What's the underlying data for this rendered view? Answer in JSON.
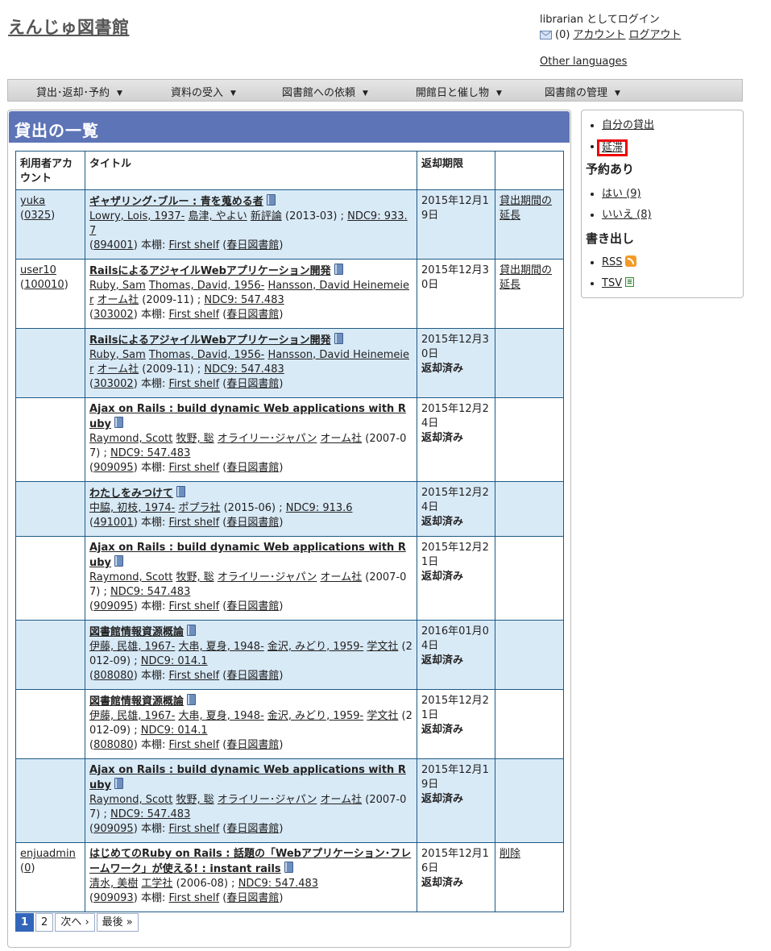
{
  "header": {
    "site_title": "えんじゅ図書館",
    "login_text": "librarian としてログイン",
    "message_count": "(0)",
    "account_link": "アカウント",
    "logout_link": "ログアウト",
    "other_languages": "Other languages"
  },
  "menu": [
    {
      "label": "貸出･返却･予約"
    },
    {
      "label": "資料の受入"
    },
    {
      "label": "図書館への依頼"
    },
    {
      "label": "開館日と催し物"
    },
    {
      "label": "図書館の管理"
    }
  ],
  "main": {
    "title": "貸出の一覧",
    "columns": [
      "利用者アカウント",
      "タイトル",
      "返却期限",
      ""
    ]
  },
  "rows": [
    {
      "user": "yuka",
      "user_id": "0325",
      "title": "ギャザリング･ブルー : 青を蒐める者",
      "authors": [
        "Lowry, Lois, 1937-",
        "島津, やよい"
      ],
      "publisher": "新評論",
      "date": "(2013-03)",
      "ndc": "NDC9: 933.7",
      "item_id": "894001",
      "shelf_label": "本棚:",
      "shelf": "First shelf",
      "library": "春日図書館",
      "due": "2015年12月19日",
      "returned": "",
      "action": "貸出期間の延長"
    },
    {
      "user": "user10",
      "user_id": "100010",
      "title": "RailsによるアジャイルWebアプリケーション開発",
      "authors": [
        "Ruby, Sam",
        "Thomas, David, 1956-",
        "Hansson, David Heinemeier"
      ],
      "publisher": "オーム社",
      "date": "(2009-11)",
      "ndc": "NDC9: 547.483",
      "item_id": "303002",
      "shelf_label": "本棚:",
      "shelf": "First shelf",
      "library": "春日図書館",
      "due": "2015年12月30日",
      "returned": "",
      "action": "貸出期間の延長"
    },
    {
      "user": "",
      "user_id": "",
      "title": "RailsによるアジャイルWebアプリケーション開発",
      "authors": [
        "Ruby, Sam",
        "Thomas, David, 1956-",
        "Hansson, David Heinemeier"
      ],
      "publisher": "オーム社",
      "date": "(2009-11)",
      "ndc": "NDC9: 547.483",
      "item_id": "303002",
      "shelf_label": "本棚:",
      "shelf": "First shelf",
      "library": "春日図書館",
      "due": "2015年12月30日",
      "returned": "返却済み",
      "action": ""
    },
    {
      "user": "",
      "user_id": "",
      "title": "Ajax on Rails : build dynamic Web applications with Ruby",
      "authors": [
        "Raymond, Scott",
        "牧野, 聡",
        "オライリー･ジャパン"
      ],
      "publisher": "オーム社",
      "date": "(2007-07)",
      "ndc": "NDC9: 547.483",
      "item_id": "909095",
      "shelf_label": "本棚:",
      "shelf": "First shelf",
      "library": "春日図書館",
      "due": "2015年12月24日",
      "returned": "返却済み",
      "action": ""
    },
    {
      "user": "",
      "user_id": "",
      "title": "わたしをみつけて",
      "authors": [
        "中脇, 初枝, 1974-"
      ],
      "publisher": "ポプラ社",
      "date": "(2015-06)",
      "ndc": "NDC9: 913.6",
      "item_id": "491001",
      "shelf_label": "本棚:",
      "shelf": "First shelf",
      "library": "春日図書館",
      "due": "2015年12月24日",
      "returned": "返却済み",
      "action": ""
    },
    {
      "user": "",
      "user_id": "",
      "title": "Ajax on Rails : build dynamic Web applications with Ruby",
      "authors": [
        "Raymond, Scott",
        "牧野, 聡",
        "オライリー･ジャパン"
      ],
      "publisher": "オーム社",
      "date": "(2007-07)",
      "ndc": "NDC9: 547.483",
      "item_id": "909095",
      "shelf_label": "本棚:",
      "shelf": "First shelf",
      "library": "春日図書館",
      "due": "2015年12月21日",
      "returned": "返却済み",
      "action": ""
    },
    {
      "user": "",
      "user_id": "",
      "title": "図書館情報資源概論",
      "authors": [
        "伊藤, 民雄, 1967-",
        "大串, 夏身, 1948-",
        "金沢, みどり, 1959-"
      ],
      "publisher": "学文社",
      "date": "(2012-09)",
      "ndc": "NDC9: 014.1",
      "item_id": "808080",
      "shelf_label": "本棚:",
      "shelf": "First shelf",
      "library": "春日図書館",
      "due": "2016年01月04日",
      "returned": "返却済み",
      "action": ""
    },
    {
      "user": "",
      "user_id": "",
      "title": "図書館情報資源概論",
      "authors": [
        "伊藤, 民雄, 1967-",
        "大串, 夏身, 1948-",
        "金沢, みどり, 1959-"
      ],
      "publisher": "学文社",
      "date": "(2012-09)",
      "ndc": "NDC9: 014.1",
      "item_id": "808080",
      "shelf_label": "本棚:",
      "shelf": "First shelf",
      "library": "春日図書館",
      "due": "2015年12月21日",
      "returned": "返却済み",
      "action": ""
    },
    {
      "user": "",
      "user_id": "",
      "title": "Ajax on Rails : build dynamic Web applications with Ruby",
      "authors": [
        "Raymond, Scott",
        "牧野, 聡",
        "オライリー･ジャパン"
      ],
      "publisher": "オーム社",
      "date": "(2007-07)",
      "ndc": "NDC9: 547.483",
      "item_id": "909095",
      "shelf_label": "本棚:",
      "shelf": "First shelf",
      "library": "春日図書館",
      "due": "2015年12月19日",
      "returned": "返却済み",
      "action": ""
    },
    {
      "user": "enjuadmin",
      "user_id": "0",
      "title": "はじめてのRuby on Rails : 話題の「Webアプリケーション･フレームワーク」が使える! : instant rails",
      "authors": [
        "清水, 美樹",
        "工学社"
      ],
      "publisher": "",
      "date": "(2006-08)",
      "ndc": "NDC9: 547.483",
      "item_id": "909093",
      "shelf_label": "本棚:",
      "shelf": "First shelf",
      "library": "春日図書館",
      "due": "2015年12月16日",
      "returned": "返却済み",
      "action": "削除"
    }
  ],
  "pagination": {
    "pages": [
      "1",
      "2"
    ],
    "current": "1",
    "next": "次へ ›",
    "last": "最後 »"
  },
  "sidebar": {
    "my_loans": "自分の貸出",
    "overdue": "延滞",
    "reserved_heading": "予約あり",
    "reserved_yes": "はい (9)",
    "reserved_no": "いいえ (8)",
    "export_heading": "書き出し",
    "rss": "RSS",
    "tsv": "TSV"
  }
}
